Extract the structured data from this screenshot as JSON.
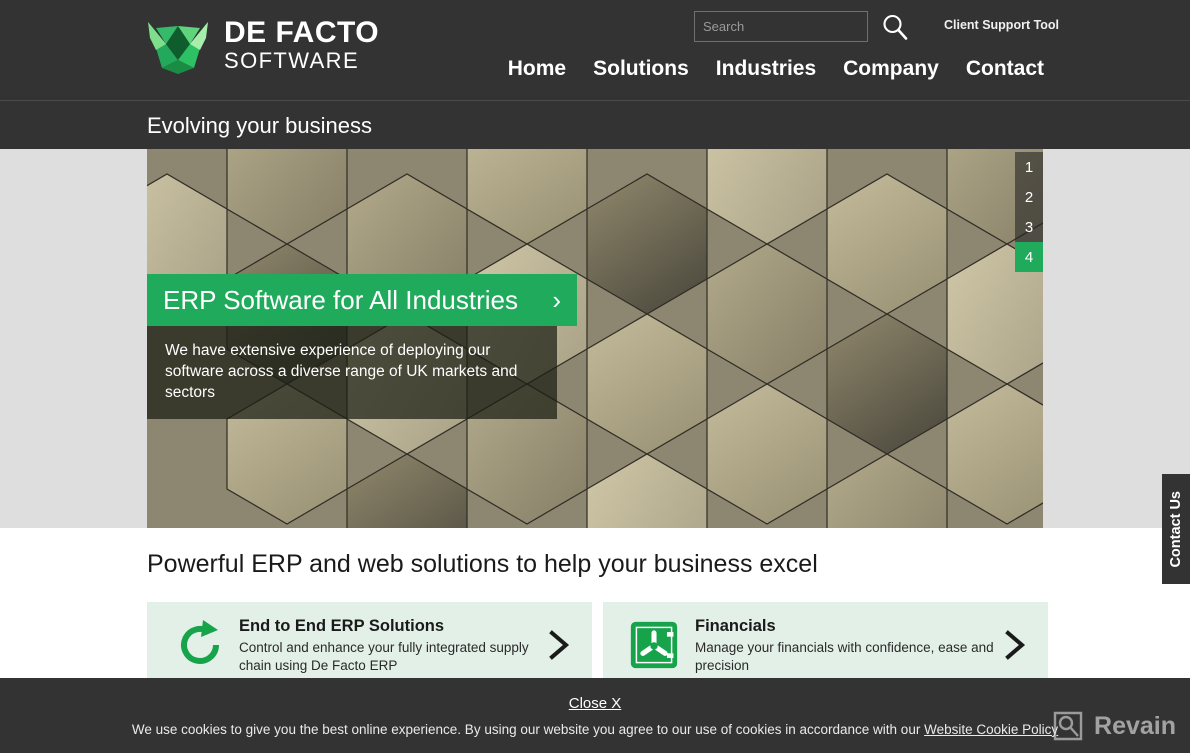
{
  "header": {
    "logo": {
      "title": "DE FACTO",
      "subtitle": "SOFTWARE",
      "icon": "de-facto-logo-icon"
    },
    "search": {
      "placeholder": "Search",
      "value": "",
      "icon": "search-icon"
    },
    "client_support_tool": "Client Support Tool",
    "nav": [
      {
        "label": "Home"
      },
      {
        "label": "Solutions"
      },
      {
        "label": "Industries"
      },
      {
        "label": "Company"
      },
      {
        "label": "Contact"
      }
    ]
  },
  "tagline": "Evolving your business",
  "hero": {
    "title": "ERP Software for All Industries",
    "chevron": "›",
    "description": "We have extensive experience of deploying our software across a diverse range of UK markets and sectors",
    "slides": [
      "1",
      "2",
      "3",
      "4"
    ],
    "active_slide": "4"
  },
  "main": {
    "heading": "Powerful ERP and web solutions to help your business excel",
    "cards": [
      {
        "title": "End to End ERP Solutions",
        "description": "Control and enhance your fully integrated supply chain using De Facto ERP",
        "icon": "circular-arrow-icon",
        "chevron": "›"
      },
      {
        "title": "Financials",
        "description": "Manage your financials with confidence, ease and precision",
        "icon": "financials-icon",
        "chevron": "›"
      }
    ]
  },
  "contact_tab": {
    "label": "Contact Us"
  },
  "cookie_bar": {
    "close_label": "Close X",
    "text": "We use cookies to give you the best online experience. By using our website you agree to our use of cookies in accordance with our ",
    "policy_link": "Website Cookie Policy"
  },
  "watermark": {
    "label": "Revain",
    "icon": "revain-logo-icon"
  },
  "colors": {
    "accent_green": "#1faa5c",
    "header_dark": "#333334",
    "page_bg": "#dedede",
    "card_bg": "#e3f0e8"
  }
}
